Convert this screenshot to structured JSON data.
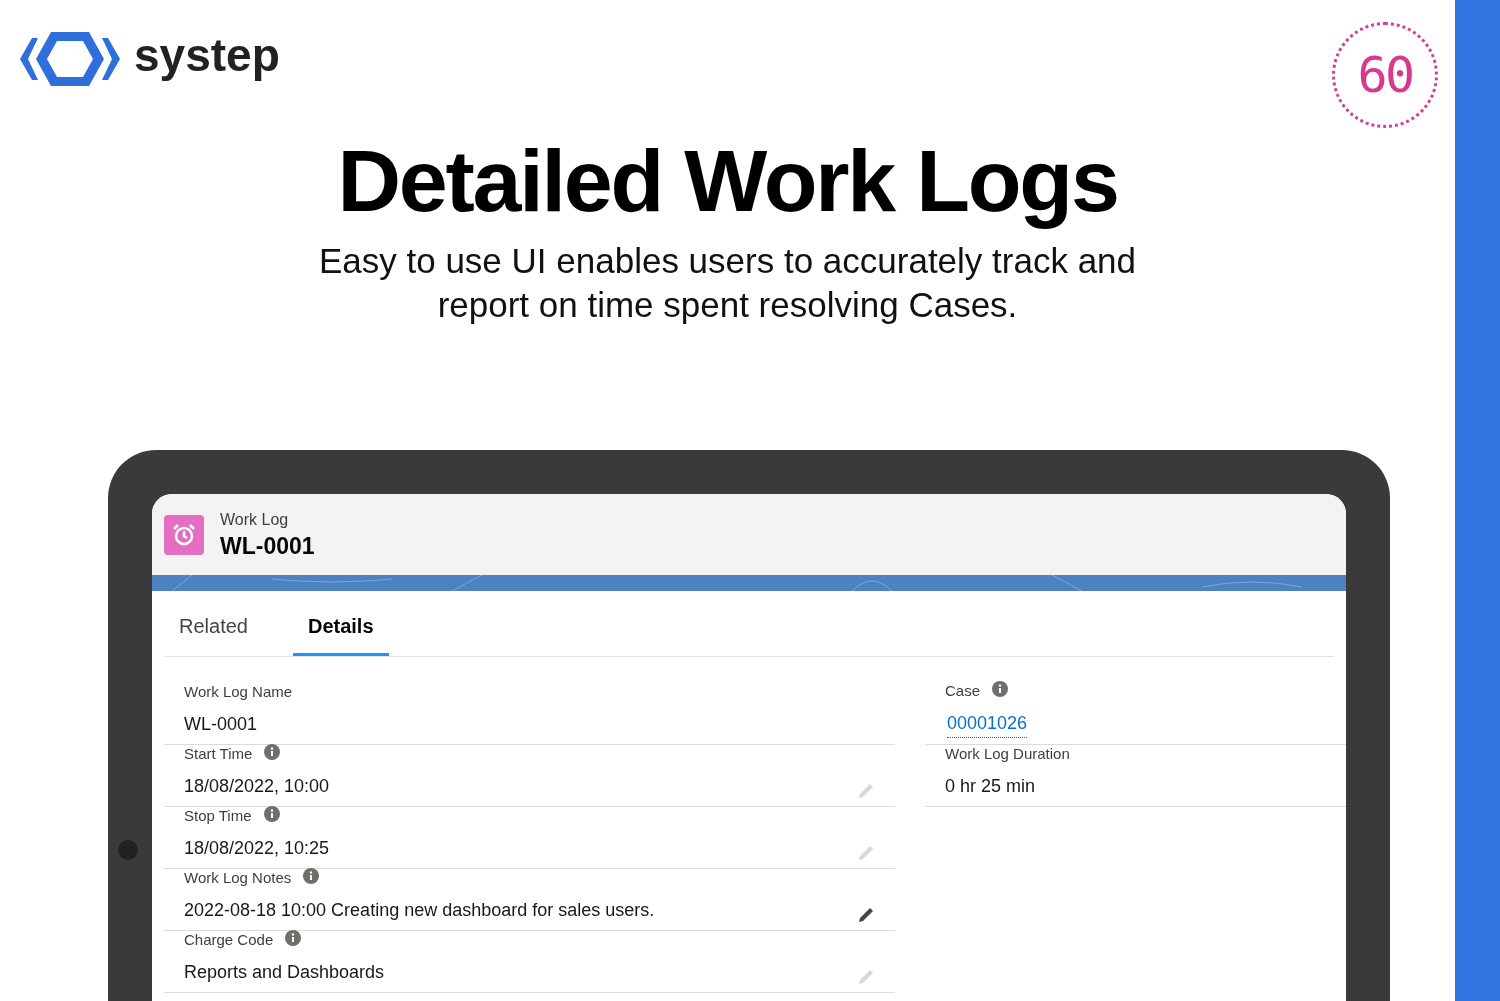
{
  "brand": {
    "name": "systep",
    "badge": "60"
  },
  "headline": "Detailed Work Logs",
  "subtitle": [
    "Easy to use UI enables users to accurately track and",
    "report on time spent resolving Cases."
  ],
  "record": {
    "object": "Work Log",
    "name": "WL-0001"
  },
  "tabs": [
    {
      "label": "Related",
      "selected": false
    },
    {
      "label": "Details",
      "selected": true
    }
  ],
  "left_fields": [
    {
      "label": "Work Log Name",
      "value": "WL-0001",
      "info": false
    },
    {
      "label": "Start Time",
      "value": "18/08/2022, 10:00",
      "info": true,
      "editable": false
    },
    {
      "label": "Stop Time",
      "value": "18/08/2022, 10:25",
      "info": true,
      "editable": false
    },
    {
      "label": "Work Log Notes",
      "value": "2022-08-18 10:00 Creating new dashboard for sales users.",
      "info": true,
      "editable": true
    },
    {
      "label": "Charge Code",
      "value": "Reports and Dashboards",
      "info": true,
      "editable": false
    }
  ],
  "right_fields": [
    {
      "label": "Case",
      "value": "00001026",
      "info": true,
      "kind": "link"
    },
    {
      "label": "Work Log Duration",
      "value": "0 hr 25 min",
      "info": false,
      "kind": "text"
    }
  ]
}
